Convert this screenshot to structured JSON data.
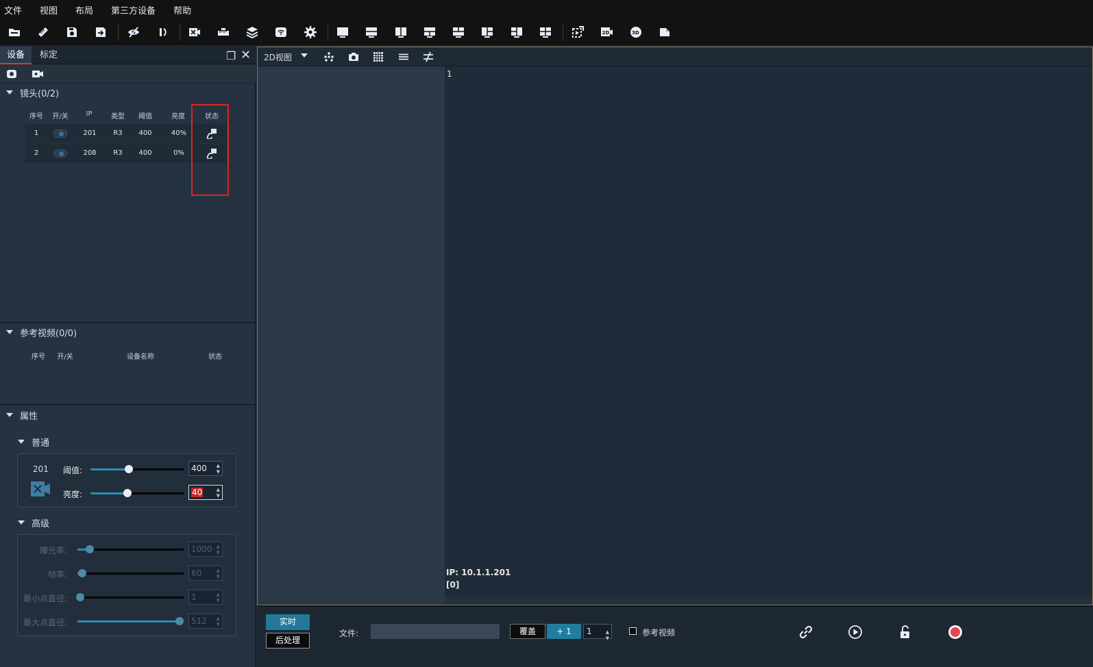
{
  "menu": [
    "文件",
    "视图",
    "布局",
    "第三方设备",
    "帮助"
  ],
  "toolbar_icons": [
    "open-folder-icon",
    "ruler-icon",
    "save-icon",
    "save-as-icon",
    "hide-icon",
    "rotate-icon",
    "camera-x-icon",
    "measure-icon",
    "layers-icon",
    "wifi-settings-icon",
    "gear-icon",
    "layout-1-icon",
    "layout-2h-icon",
    "layout-2v-icon",
    "layout-3a-icon",
    "layout-3b-icon",
    "layout-3c-icon",
    "layout-4a-icon",
    "layout-4b-icon",
    "record-region-icon",
    "view-2d-icon",
    "view-3d-icon",
    "document-icon"
  ],
  "tabs": [
    "设备",
    "标定"
  ],
  "lens_section": {
    "title": "镜头(0/2)",
    "headers": [
      "序号",
      "开/关",
      "IP",
      "类型",
      "阈值",
      "亮度",
      "状态"
    ],
    "rows": [
      {
        "index": "1",
        "ip": "201",
        "type": "R3",
        "threshold": "400",
        "brightness": "40%"
      },
      {
        "index": "2",
        "ip": "208",
        "type": "R3",
        "threshold": "400",
        "brightness": "0%"
      }
    ]
  },
  "ref_section": {
    "title": "参考视频(0/0)",
    "headers": [
      "序号",
      "开/关",
      "设备名称",
      "状态"
    ]
  },
  "props": {
    "title": "属性",
    "normal_title": "普通",
    "device_id": "201",
    "threshold_label": "阈值:",
    "threshold_value": "400",
    "threshold_level": 0.41,
    "brightness_label": "亮度:",
    "brightness_value": "40",
    "brightness_level": 0.4,
    "advanced_title": "高级",
    "exposure_label": "曝光率:",
    "exposure_value": "1000",
    "framerate_label": "帧率:",
    "framerate_value": "60",
    "min_dot_label": "最小点直径:",
    "min_dot_value": "1",
    "max_dot_label": "最大点直径:",
    "max_dot_value": "512"
  },
  "view": {
    "mode": "2D视图",
    "pane_number": "1",
    "ip_text": "IP: 10.1.1.201",
    "count_text": "[0]"
  },
  "bottom": {
    "realtime": "实时",
    "postprocess": "后处理",
    "file_label": "文件:",
    "cover": "覆盖",
    "plus_one": "+ 1",
    "spin_value": "1",
    "ref_video": "参考视频"
  },
  "colors": {
    "accent": "#23799a",
    "highlight_box": "#e02424",
    "record": "#e5484d"
  }
}
